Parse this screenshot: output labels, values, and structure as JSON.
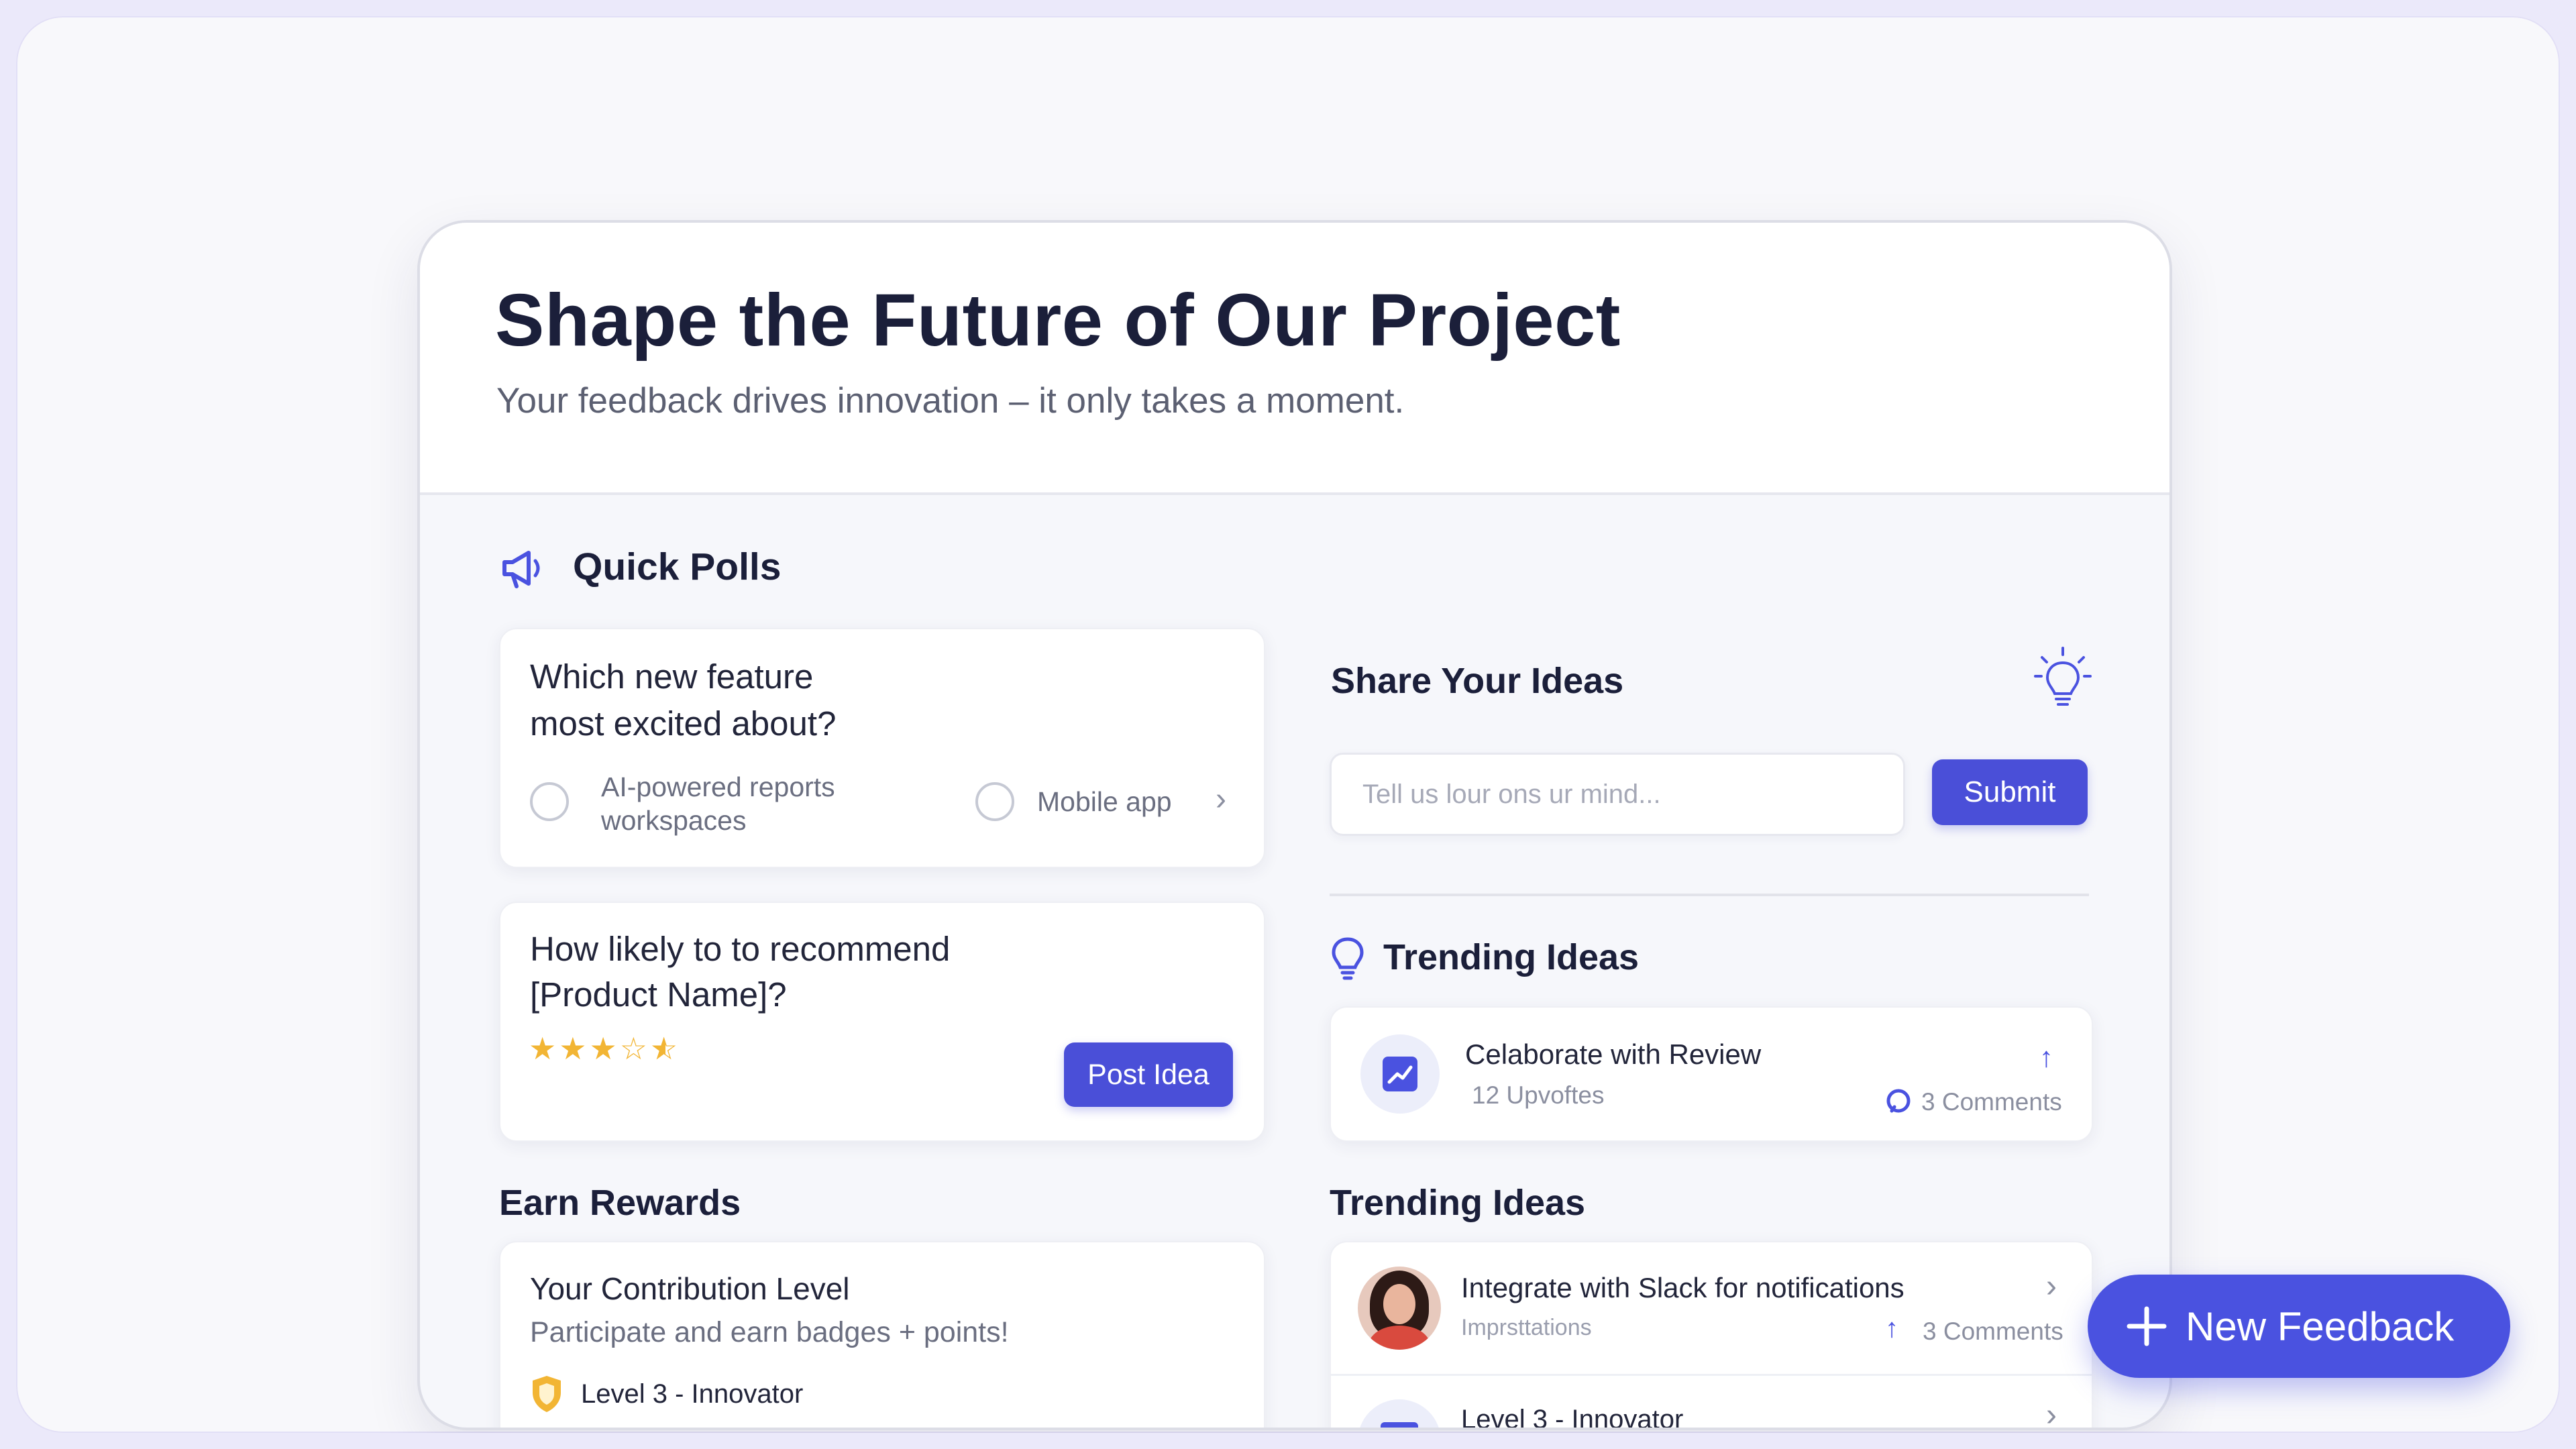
{
  "header": {
    "title": "Shape the Future of Our Project",
    "subtitle": "Your feedback drives innovation – it only takes a moment."
  },
  "quick_polls": {
    "title": "Quick Polls",
    "icon": "megaphone-icon",
    "poll1": {
      "question_line1": "Which new feature",
      "question_line2": "most excited about?",
      "option1_line1": "AI-powered reports",
      "option1_line2": "workspaces",
      "option2": "Mobile app"
    },
    "poll2": {
      "question_line1": "How likely to to recommend",
      "question_line2": "[Product Name]?",
      "rating_stars": 3.5,
      "rating_max": 5,
      "post_button": "Post Idea"
    }
  },
  "share_ideas": {
    "title": "Share Your Ideas",
    "icon": "lightbulb-icon",
    "input_placeholder": "Tell us lour ons ur mind...",
    "submit_label": "Submit"
  },
  "trending_top": {
    "title": "Trending Ideas",
    "item": {
      "title": "Celaborate with Review",
      "upvotes": "12 Upvoftes",
      "comments": "3 Comments"
    }
  },
  "earn_rewards": {
    "title": "Earn Rewards",
    "panel_title": "Your Contribution Level",
    "panel_subtitle": "Participate and earn badges + points!",
    "level": "Level 3 - Innovator"
  },
  "trending_bottom": {
    "title": "Trending Ideas",
    "items": [
      {
        "title": "Integrate with Slack for notifications",
        "sub": "Imprsttations",
        "comments": "3 Comments"
      },
      {
        "title": "Level 3 - Innovator"
      }
    ]
  },
  "fab": {
    "label": "New Feedback"
  },
  "colors": {
    "accent": "#4a4fd8",
    "star": "#f2b534",
    "shield": "#f2b534"
  }
}
